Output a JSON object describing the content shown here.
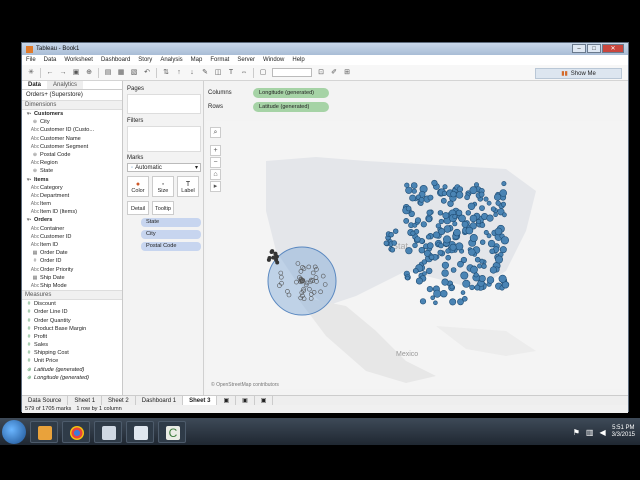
{
  "window": {
    "title": "Tableau - Book1"
  },
  "menu": [
    "File",
    "Data",
    "Worksheet",
    "Dashboard",
    "Story",
    "Analysis",
    "Map",
    "Format",
    "Server",
    "Window",
    "Help"
  ],
  "toolbar": {
    "show_me": "Show Me"
  },
  "data_pane": {
    "tabs": [
      "Data",
      "Analytics"
    ],
    "source": "Orders+ (Superstore)",
    "dimensions_header": "Dimensions",
    "dimensions": [
      {
        "label": "Customers",
        "type": "folder"
      },
      {
        "label": "City",
        "type": "geo"
      },
      {
        "label": "Customer ID (Custo...",
        "type": "abc"
      },
      {
        "label": "Customer Name",
        "type": "abc"
      },
      {
        "label": "Customer Segment",
        "type": "abc"
      },
      {
        "label": "Postal Code",
        "type": "geo"
      },
      {
        "label": "Region",
        "type": "abc"
      },
      {
        "label": "State",
        "type": "geo"
      },
      {
        "label": "Items",
        "type": "folder"
      },
      {
        "label": "Category",
        "type": "abc"
      },
      {
        "label": "Department",
        "type": "abc"
      },
      {
        "label": "Item",
        "type": "abc"
      },
      {
        "label": "Item ID (Items)",
        "type": "abc"
      },
      {
        "label": "Orders",
        "type": "folder"
      },
      {
        "label": "Container",
        "type": "abc"
      },
      {
        "label": "Customer ID",
        "type": "abc"
      },
      {
        "label": "Item ID",
        "type": "abc"
      },
      {
        "label": "Order Date",
        "type": "date"
      },
      {
        "label": "Order ID",
        "type": "num"
      },
      {
        "label": "Order Priority",
        "type": "abc"
      },
      {
        "label": "Ship Date",
        "type": "date"
      },
      {
        "label": "Ship Mode",
        "type": "abc"
      }
    ],
    "measures_header": "Measures",
    "measures": [
      {
        "label": "Discount",
        "gen": false
      },
      {
        "label": "Order Line ID",
        "gen": false
      },
      {
        "label": "Order Quantity",
        "gen": false
      },
      {
        "label": "Product Base Margin",
        "gen": false
      },
      {
        "label": "Profit",
        "gen": false
      },
      {
        "label": "Sales",
        "gen": false
      },
      {
        "label": "Shipping Cost",
        "gen": false
      },
      {
        "label": "Unit Price",
        "gen": false
      },
      {
        "label": "Latitude (generated)",
        "gen": true
      },
      {
        "label": "Longitude (generated)",
        "gen": true
      }
    ]
  },
  "cards": {
    "pages": "Pages",
    "filters": "Filters",
    "marks": "Marks",
    "mark_type": "Automatic",
    "mark_buttons": [
      "Color",
      "Size",
      "Label",
      "Detail",
      "Tooltip"
    ],
    "mark_pills": [
      "State",
      "City",
      "Postal Code"
    ]
  },
  "shelves": {
    "columns_label": "Columns",
    "columns_pill": "Longitude (generated)",
    "rows_label": "Rows",
    "rows_pill": "Latitude (generated)"
  },
  "map": {
    "label_states": "Stat",
    "label_mexico": "Mexico",
    "attribution": "© OpenStreetMap contributors",
    "dot_color": "#4a84b4",
    "selection_color": "#7fa8d8"
  },
  "sheet_tabs": [
    "Data Source",
    "Sheet 1",
    "Sheet 2",
    "Dashboard 1",
    "Sheet 3"
  ],
  "active_tab": "Sheet 3",
  "status": {
    "marks": "579 of 1705 marks",
    "rows": "1 row by 1 column"
  },
  "taskbar": {
    "time": "5:51 PM",
    "date": "3/3/2015"
  }
}
